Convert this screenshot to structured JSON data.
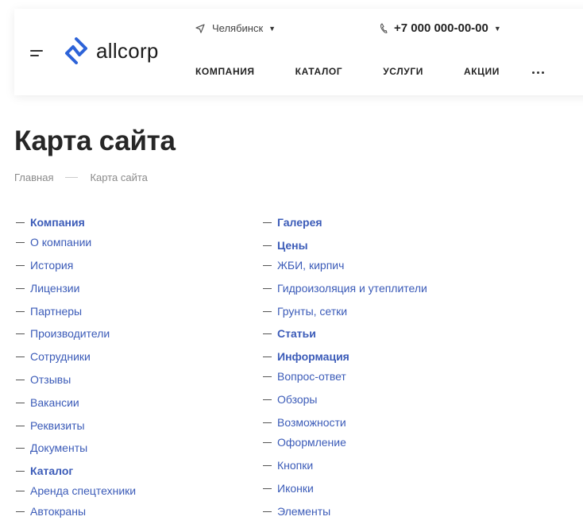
{
  "header": {
    "logo_text": "allcorp",
    "city": "Челябинск",
    "phone": "+7 000 000-00-00",
    "nav": [
      "КОМПАНИЯ",
      "КАТАЛОГ",
      "УСЛУГИ",
      "АКЦИИ"
    ]
  },
  "page": {
    "title": "Карта сайта",
    "breadcrumbs": [
      "Главная",
      "Карта сайта"
    ]
  },
  "sitemap": {
    "left": [
      {
        "label": "Компания",
        "head": true
      },
      {
        "label": "О компании"
      },
      {
        "label": "История"
      },
      {
        "label": "Лицензии"
      },
      {
        "label": "Партнеры"
      },
      {
        "label": "Производители"
      },
      {
        "label": "Сотрудники"
      },
      {
        "label": "Отзывы"
      },
      {
        "label": "Вакансии"
      },
      {
        "label": "Реквизиты"
      },
      {
        "label": "Документы"
      },
      {
        "label": "Каталог",
        "head": true
      },
      {
        "label": "Аренда спецтехники"
      },
      {
        "label": "Автокраны"
      }
    ],
    "right": [
      {
        "label": "Галерея",
        "head": true
      },
      {
        "label": "Цены",
        "head": true
      },
      {
        "label": "ЖБИ, кирпич"
      },
      {
        "label": "Гидроизоляция и утеплители"
      },
      {
        "label": "Грунты, сетки"
      },
      {
        "label": "Статьи",
        "head": true
      },
      {
        "label": "Информация",
        "head": true
      },
      {
        "label": "Вопрос-ответ"
      },
      {
        "label": "Обзоры"
      },
      {
        "label": "Возможности"
      },
      {
        "label": "Оформление"
      },
      {
        "label": "Кнопки"
      },
      {
        "label": "Иконки"
      },
      {
        "label": "Элементы"
      }
    ]
  }
}
